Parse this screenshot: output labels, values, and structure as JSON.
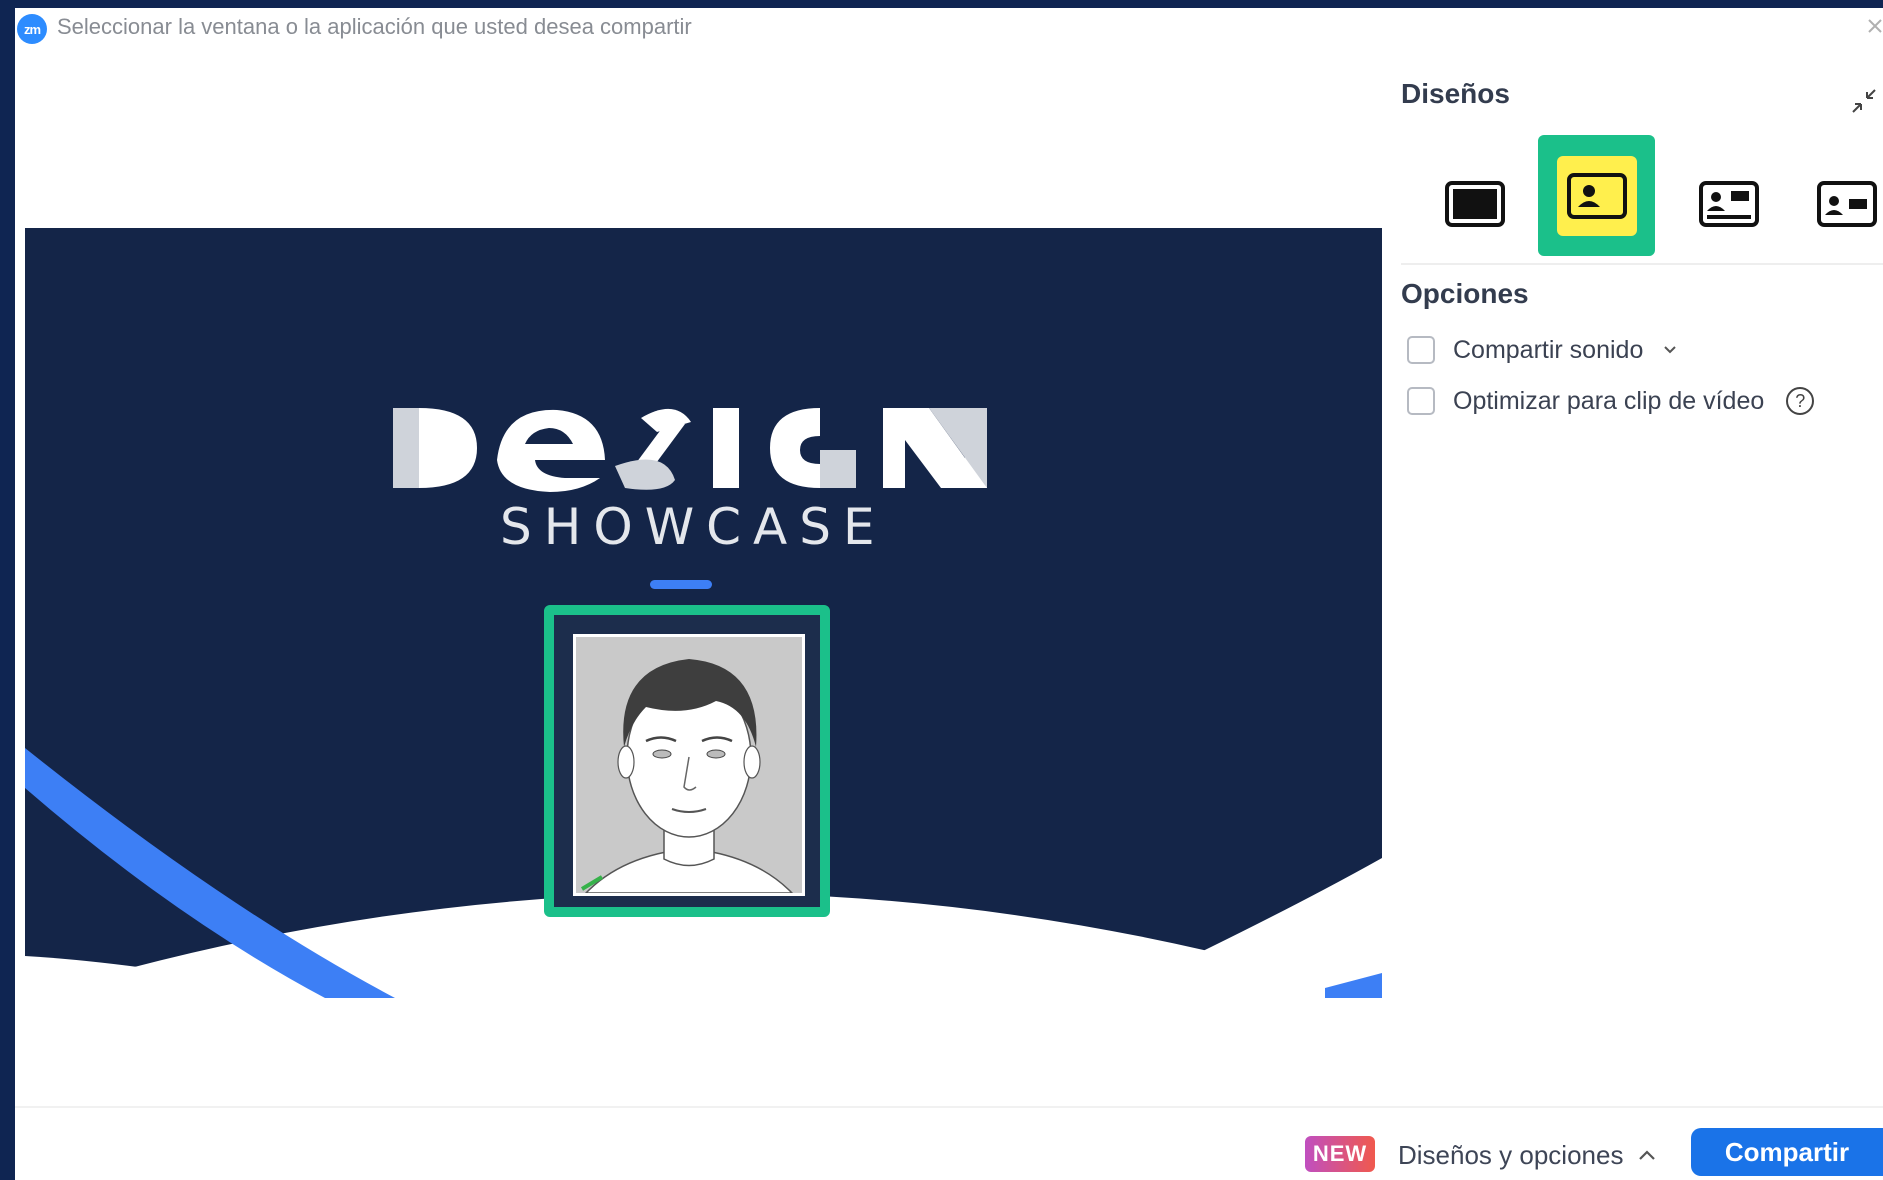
{
  "window": {
    "title": "Seleccionar la ventana o la aplicación que usted desea compartir",
    "logo_text": "zm"
  },
  "preview": {
    "logo_word": "DESIGN",
    "subtitle": "SHOWCASE"
  },
  "panel": {
    "layouts_title": "Diseños",
    "layouts": [
      {
        "name": "screen-only",
        "selected": false
      },
      {
        "name": "picture-in-picture",
        "selected": true
      },
      {
        "name": "presenter-top-left",
        "selected": false
      },
      {
        "name": "presenter-side",
        "selected": false
      }
    ],
    "options_title": "Opciones",
    "options": [
      {
        "label": "Compartir sonido",
        "checked": false
      },
      {
        "label": "Optimizar para clip de vídeo",
        "checked": false
      }
    ]
  },
  "footer": {
    "new_badge": "NEW",
    "layouts_options_label": "Diseños y opciones",
    "share_label": "Compartir"
  },
  "colors": {
    "accent_blue": "#1a73e8",
    "highlight_green": "#1bc08a",
    "selected_yellow": "#ffef4d",
    "preview_navy": "#142548"
  }
}
